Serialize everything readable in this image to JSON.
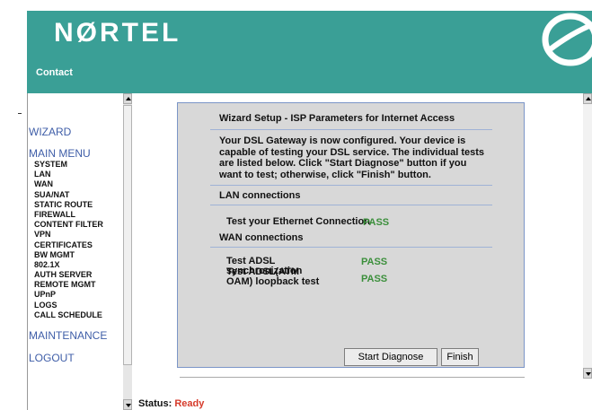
{
  "header": {
    "logo": "NØRTEL",
    "contact_label": "Contact",
    "bg_color": "#3a9f96"
  },
  "sidebar": {
    "wizard": "WIZARD",
    "main_menu": "MAIN MENU",
    "items": [
      "SYSTEM",
      "LAN",
      "WAN",
      "SUA/NAT",
      "STATIC ROUTE",
      "FIREWALL",
      "CONTENT FILTER",
      "VPN",
      "CERTIFICATES",
      "BW MGMT",
      "802.1X",
      "AUTH SERVER",
      "REMOTE MGMT",
      "UPnP",
      "LOGS",
      "CALL SCHEDULE"
    ],
    "maintenance": "MAINTENANCE",
    "logout": "LOGOUT"
  },
  "panel": {
    "title": "Wizard Setup - ISP Parameters for Internet Access",
    "description": "Your DSL Gateway is now configured. Your device is capable of testing your DSL service. The individual tests are listed below. Click \"Start Diagnose\" button if you want to test; otherwise, click \"Finish\" button.",
    "lan_section": "LAN connections",
    "lan_test": {
      "label": "Test your Ethernet Connection",
      "result": "PASS"
    },
    "wan_section": "WAN connections",
    "wan_tests": [
      {
        "label": "Test ADSL synchronization",
        "result": "PASS"
      },
      {
        "label": "Test ADSL(ATM OAM) loopback test",
        "result": "PASS"
      }
    ],
    "start_button": "Start Diagnose",
    "finish_button": "Finish"
  },
  "status": {
    "label": "Status:",
    "value": "Ready"
  }
}
